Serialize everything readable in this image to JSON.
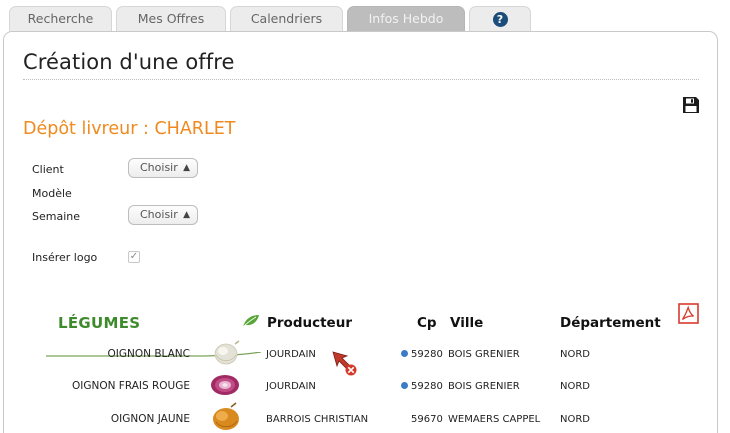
{
  "tabs": [
    {
      "label": "Recherche"
    },
    {
      "label": "Mes Offres"
    },
    {
      "label": "Calendriers"
    },
    {
      "label": "Infos Hebdo",
      "active": true
    },
    {
      "label": "?",
      "icon": "help-icon"
    }
  ],
  "page": {
    "title": "Création d'une offre",
    "depot_title": "Dépôt livreur : CHARLET"
  },
  "form": {
    "client_label": "Client",
    "client_value": "Choisir",
    "modele_label": "Modèle",
    "semaine_label": "Semaine",
    "semaine_value": "Choisir",
    "logo_label": "Insérer logo",
    "logo_checked": true
  },
  "icons": {
    "save": "save-icon",
    "pdf": "pdf-icon",
    "leaf": "leaf-icon",
    "globe": "globe-icon",
    "cursor": "cursor-arrow-icon"
  },
  "colors": {
    "accent_orange": "#f08a1f",
    "legumes_green": "#3e8a2d",
    "tab_active": "#bdbdbd",
    "pdf_red": "#d93a2b",
    "help_blue": "#1a4d79"
  },
  "table": {
    "category": "LÉGUMES",
    "headers": {
      "producteur": "Producteur",
      "cp": "Cp",
      "ville": "Ville",
      "departement": "Département"
    },
    "rows": [
      {
        "product": "OIGNON BLANC",
        "producteur": "JOURDAIN",
        "cp": "59280",
        "ville": "BOIS GRENIER",
        "departement": "NORD",
        "globe": true,
        "image": "white-onion"
      },
      {
        "product": "OIGNON FRAIS ROUGE",
        "producteur": "JOURDAIN",
        "cp": "59280",
        "ville": "BOIS GRENIER",
        "departement": "NORD",
        "globe": true,
        "image": "red-onion"
      },
      {
        "product": "OIGNON JAUNE",
        "producteur": "BARROIS CHRISTIAN",
        "cp": "59670",
        "ville": "WEMAERS CAPPEL",
        "departement": "NORD",
        "globe": false,
        "image": "yellow-onion"
      }
    ]
  }
}
